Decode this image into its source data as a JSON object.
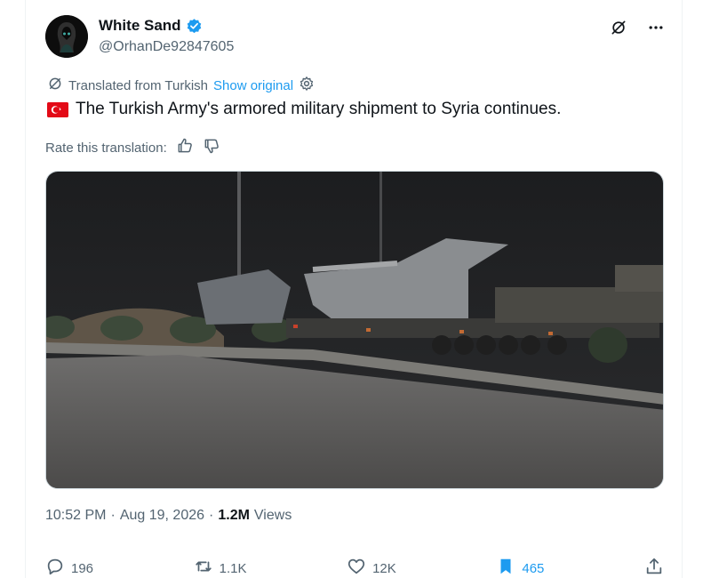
{
  "author": {
    "display_name": "White Sand",
    "handle": "@OrhanDe92847605",
    "verified": true
  },
  "translation": {
    "note": "Translated from Turkish",
    "show_original": "Show original",
    "rate_label": "Rate this translation:"
  },
  "tweet": {
    "text": "The Turkish Army's armored military shipment to Syria continues."
  },
  "meta": {
    "time": "10:52 PM",
    "date": "Aug 19, 2026",
    "views_count": "1.2M",
    "views_label": "Views"
  },
  "actions": {
    "replies": "196",
    "reposts": "1.1K",
    "likes": "12K",
    "bookmarks": "465"
  },
  "colors": {
    "accent": "#1d9bf0",
    "text_primary": "#0f1419",
    "text_secondary": "#536471"
  }
}
